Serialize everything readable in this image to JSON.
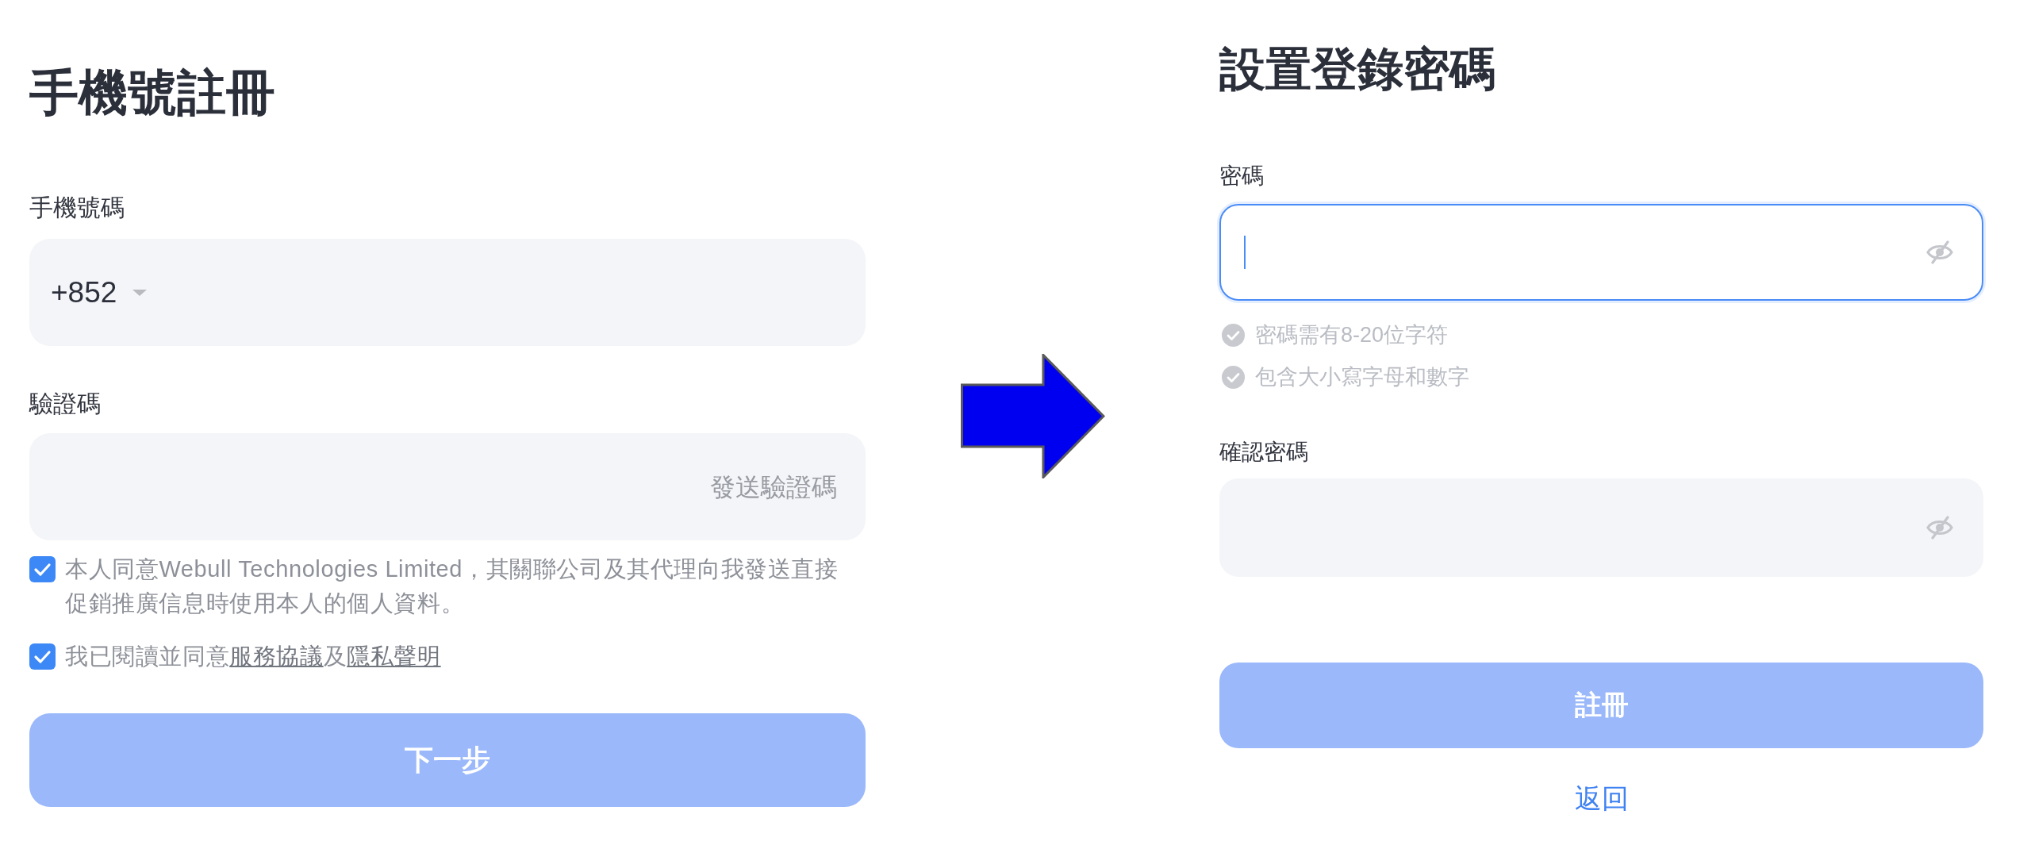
{
  "phone_registration": {
    "title": "手機號註冊",
    "phone_field": {
      "label": "手機號碼",
      "country_code": "+852"
    },
    "code_field": {
      "label": "驗證碼",
      "send_code": "發送驗證碼"
    },
    "agreements": [
      {
        "checked": true,
        "segments": [
          {
            "kind": "text",
            "text": "本人同意Webull Technologies Limited，其關聯公司及其代理向我發送直接促銷推廣信息時使用本人的個人資料。"
          }
        ]
      },
      {
        "checked": true,
        "segments": [
          {
            "kind": "text",
            "text": "我已閱讀並同意"
          },
          {
            "kind": "link",
            "text": "服務協議"
          },
          {
            "kind": "text",
            "text": "及"
          },
          {
            "kind": "link",
            "text": "隱私聲明"
          }
        ]
      }
    ],
    "next_button": {
      "label": "下一步",
      "disabled": true
    }
  },
  "set_password": {
    "title": "設置登錄密碼",
    "password_field": {
      "label": "密碼",
      "focused": true
    },
    "requirements": [
      {
        "text": "密碼需有8-20位字符",
        "met": false
      },
      {
        "text": "包含大小寫字母和數字",
        "met": false
      }
    ],
    "confirm_field": {
      "label": "確認密碼",
      "focused": false
    },
    "register_button": {
      "label": "註冊",
      "disabled": true
    },
    "back_link": "返回"
  }
}
